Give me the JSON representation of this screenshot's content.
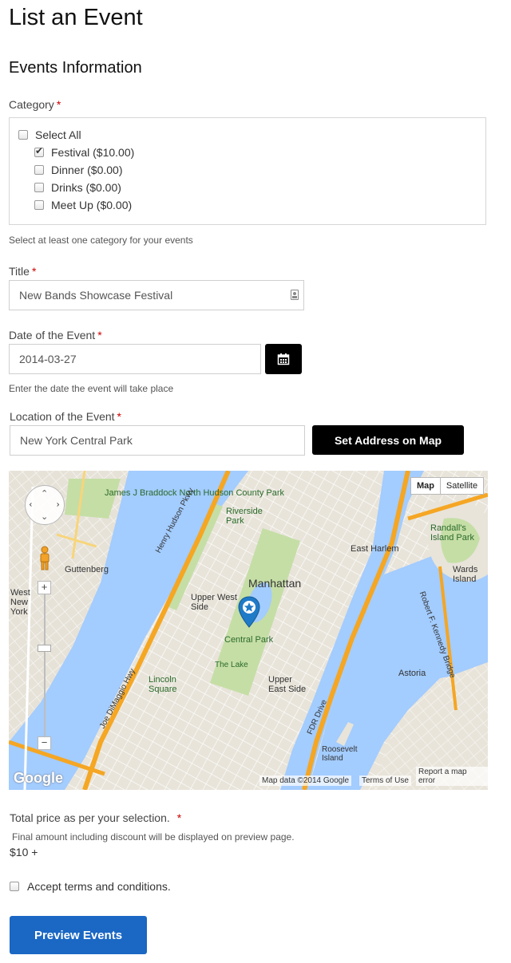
{
  "page": {
    "title": "List an Event"
  },
  "section": {
    "title": "Events Information"
  },
  "category": {
    "label": "Category",
    "required_mark": "*",
    "select_all": "Select All",
    "options": [
      {
        "label": "Festival ($10.00)",
        "checked": true
      },
      {
        "label": "Dinner ($0.00)",
        "checked": false
      },
      {
        "label": "Drinks ($0.00)",
        "checked": false
      },
      {
        "label": "Meet Up ($0.00)",
        "checked": false
      }
    ],
    "hint": "Select at least one category for your events"
  },
  "title_field": {
    "label": "Title",
    "required_mark": "*",
    "value": "New Bands Showcase Festival"
  },
  "date_field": {
    "label": "Date of the Event",
    "required_mark": "*",
    "value": "2014-03-27",
    "hint": "Enter the date the event will take place",
    "button_icon": "calendar-icon"
  },
  "location_field": {
    "label": "Location of the Event",
    "required_mark": "*",
    "value": "New York Central Park",
    "button_label": "Set Address on Map"
  },
  "map": {
    "type_buttons": [
      "Map",
      "Satellite"
    ],
    "labels": {
      "manhattan": "Manhattan",
      "central_park": "Central Park",
      "upper_west_side": "Upper West Side",
      "upper_east_side": "Upper East Side",
      "riverside_park": "Riverside Park",
      "east_harlem": "East Harlem",
      "randalls_island": "Randall's Island Park",
      "wards_island": "Wards Island",
      "astoria": "Astoria",
      "roosevelt_island": "Roosevelt Island",
      "lincoln_square": "Lincoln Square",
      "north_hudson": "James J Braddock North Hudson County Park",
      "guttenberg": "Guttenberg",
      "west_new_york": "West New York",
      "the_lake": "The Lake",
      "fdr_drive": "FDR Drive",
      "henry_hudson": "Henry Hudson Pkwy",
      "joe_dimaggio": "Joe DiMaggio Hwy",
      "rfk_bridge": "Robert F. Kennedy Bridge"
    },
    "footer": {
      "data": "Map data ©2014 Google",
      "terms": "Terms of Use",
      "report": "Report a map error"
    },
    "logo": "Google"
  },
  "total": {
    "label": "Total price as per your selection.",
    "required_mark": "*",
    "note": "Final amount including discount will be displayed on preview page.",
    "value": "$10 +"
  },
  "terms": {
    "label": "Accept terms and conditions.",
    "checked": false
  },
  "preview_button": {
    "label": "Preview Events"
  },
  "colors": {
    "primary": "#1a67c4",
    "required": "#cc0000",
    "water": "#a3ccff",
    "park": "#c5dea6",
    "highway": "#f5a623"
  }
}
